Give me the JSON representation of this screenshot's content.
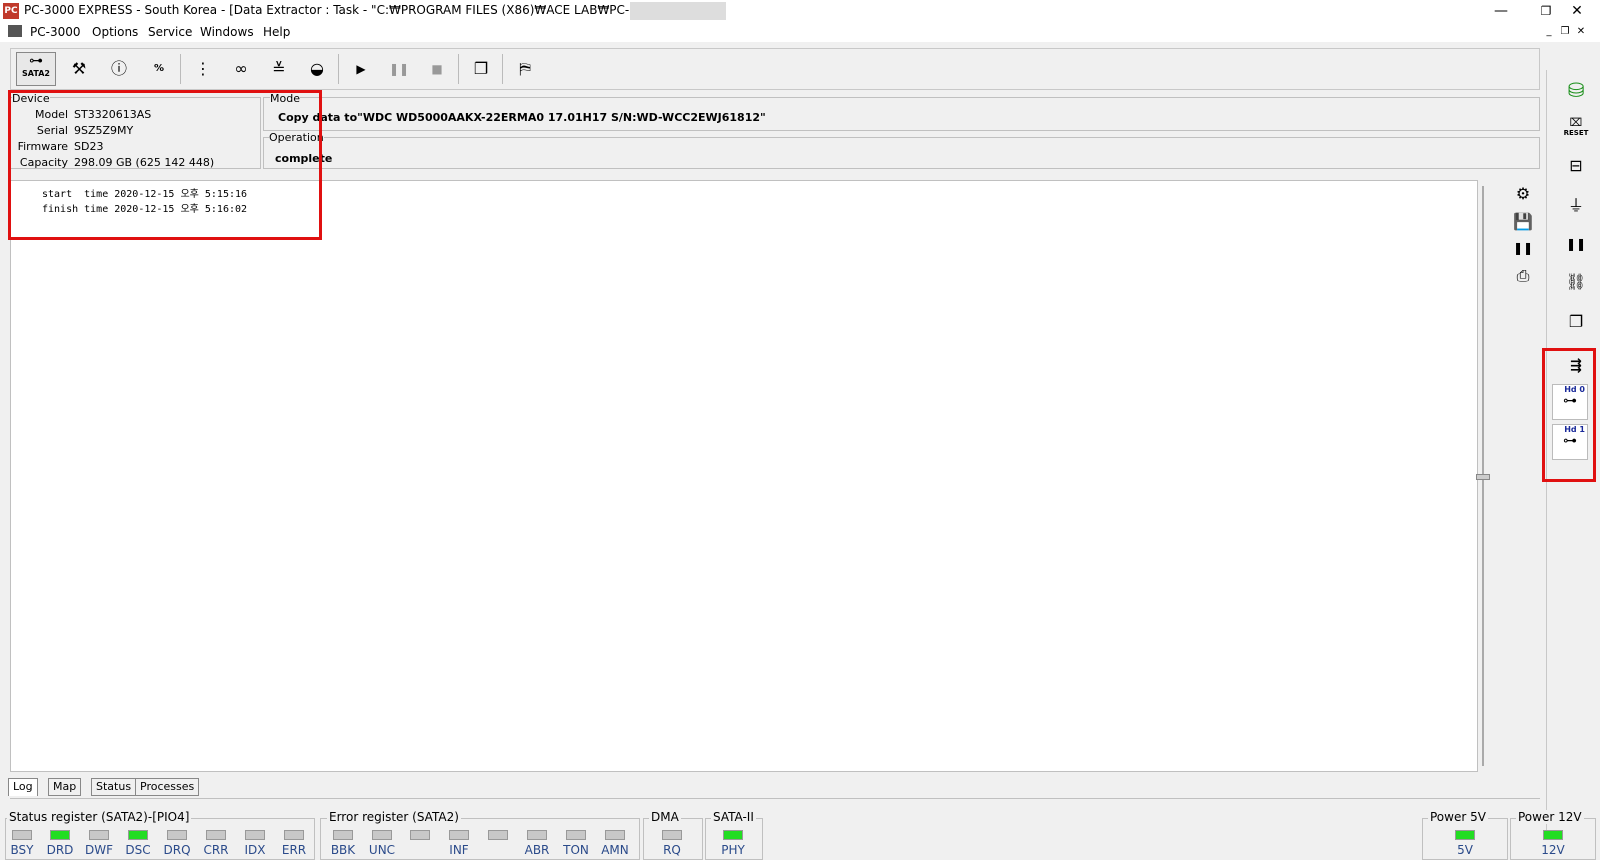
{
  "window": {
    "title": "PC-3000 EXPRESS - South Korea - [Data Extractor : Task - \"C:₩PROGRAM FILES (X86)₩ACE LAB₩PC-3000₩BIN₩",
    "app_icon_text": "PC",
    "minimize": "—",
    "restore": "❐",
    "close": "✕"
  },
  "menu": {
    "items": [
      "PC-3000",
      "Options",
      "Service",
      "Windows",
      "Help"
    ],
    "mdi_min": "_",
    "mdi_restore": "❐",
    "mdi_close": "✕"
  },
  "toolbar": {
    "sata2_label": "SATA2",
    "icons": [
      "sata2-icon",
      "tools-icon",
      "id-icon",
      "percent-icon",
      "tree-icon",
      "binoculars-icon",
      "stack-icon",
      "disk-icon",
      "play-icon",
      "pause-icon",
      "stop-icon",
      "windows-icon",
      "exit-icon"
    ]
  },
  "device": {
    "legend": "Device",
    "model_label": "Model",
    "model": "ST3320613AS",
    "serial_label": "Serial",
    "serial": "9SZ5Z9MY",
    "firmware_label": "Firmware",
    "firmware": "SD23",
    "capacity_label": "Capacity",
    "capacity": "298.09 GB (625 142 448)"
  },
  "mode": {
    "legend": "Mode",
    "text": "Copy data to\"WDC WD5000AAKX-22ERMA0 17.01H17 S/N:WD-WCC2EWJ61812\""
  },
  "operation": {
    "legend": "Operation",
    "text": "complete"
  },
  "log": {
    "lines": [
      "start  time 2020-12-15 오후 5:15:16",
      "finish time 2020-12-15 오후 5:16:02"
    ]
  },
  "tabs": [
    "Log",
    "Map",
    "Status",
    "Processes"
  ],
  "active_tab": "Log",
  "right_panel": {
    "hd0": "Hd 0",
    "hd1": "Hd 1",
    "reset": "RESET"
  },
  "status": {
    "status_register": {
      "title": "Status register (SATA2)-[PIO4]",
      "leds": [
        {
          "label": "BSY",
          "on": false
        },
        {
          "label": "DRD",
          "on": true
        },
        {
          "label": "DWF",
          "on": false
        },
        {
          "label": "DSC",
          "on": true
        },
        {
          "label": "DRQ",
          "on": false
        },
        {
          "label": "CRR",
          "on": false
        },
        {
          "label": "IDX",
          "on": false
        },
        {
          "label": "ERR",
          "on": false
        }
      ]
    },
    "error_register": {
      "title": "Error register (SATA2)",
      "leds": [
        {
          "label": "BBK",
          "on": false
        },
        {
          "label": "UNC",
          "on": false
        },
        {
          "label": "",
          "on": false
        },
        {
          "label": "INF",
          "on": false
        },
        {
          "label": "",
          "on": false
        },
        {
          "label": "ABR",
          "on": false
        },
        {
          "label": "TON",
          "on": false
        },
        {
          "label": "AMN",
          "on": false
        }
      ]
    },
    "dma": {
      "title": "DMA",
      "label": "RQ",
      "on": false
    },
    "sata": {
      "title": "SATA-II",
      "label": "PHY",
      "on": true
    },
    "power5": {
      "title": "Power 5V",
      "label": "5V",
      "on": true
    },
    "power12": {
      "title": "Power 12V",
      "label": "12V",
      "on": true
    }
  },
  "colors": {
    "led_on": "#22dd22",
    "highlight": "#e01010"
  }
}
